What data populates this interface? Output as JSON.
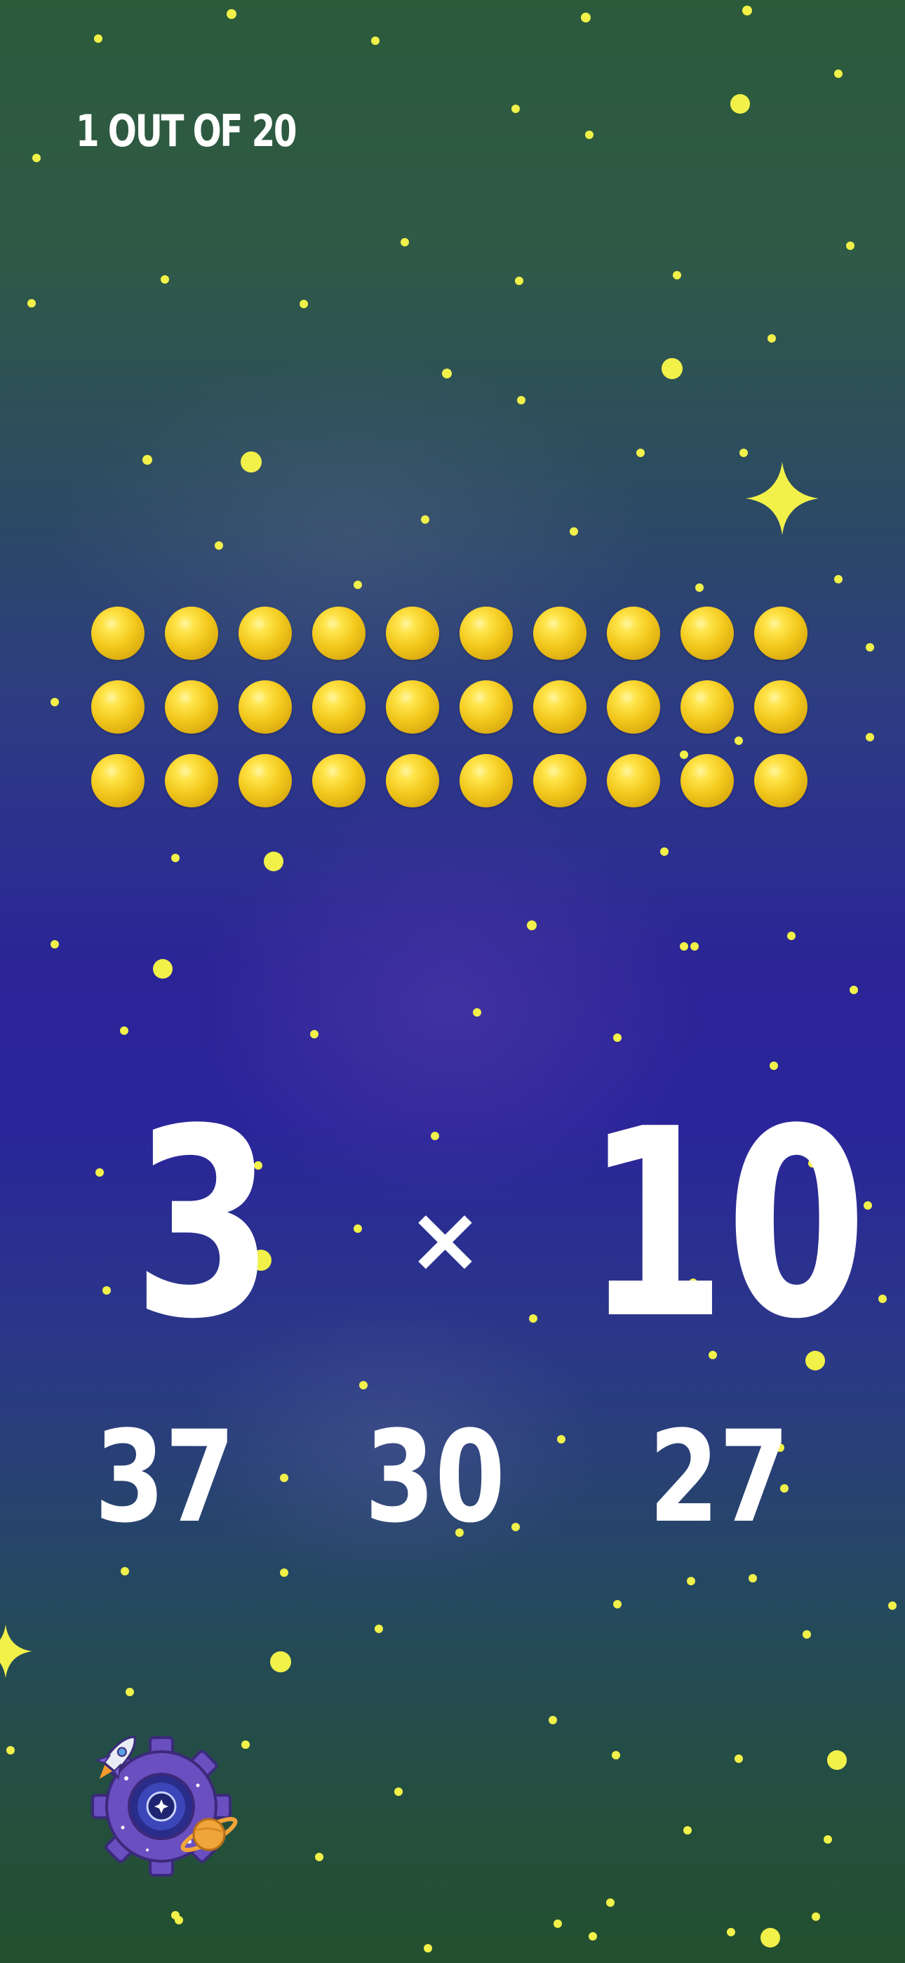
{
  "progress": {
    "label": "1 OUT OF 20",
    "current": 1,
    "total": 20
  },
  "visual_model": {
    "rows": 3,
    "columns": 10,
    "ball_color": "#f2c81c"
  },
  "problem": {
    "left_operand": "3",
    "operator": "×",
    "right_operand": "10"
  },
  "answers": [
    {
      "label": "37"
    },
    {
      "label": "30"
    },
    {
      "label": "27"
    }
  ],
  "settings": {
    "icon": "space-gear-icon"
  },
  "colors": {
    "star": "#f1f14a",
    "text": "#ffffff",
    "gear": "#6a4fc0",
    "planet": "#f0a53a"
  }
}
